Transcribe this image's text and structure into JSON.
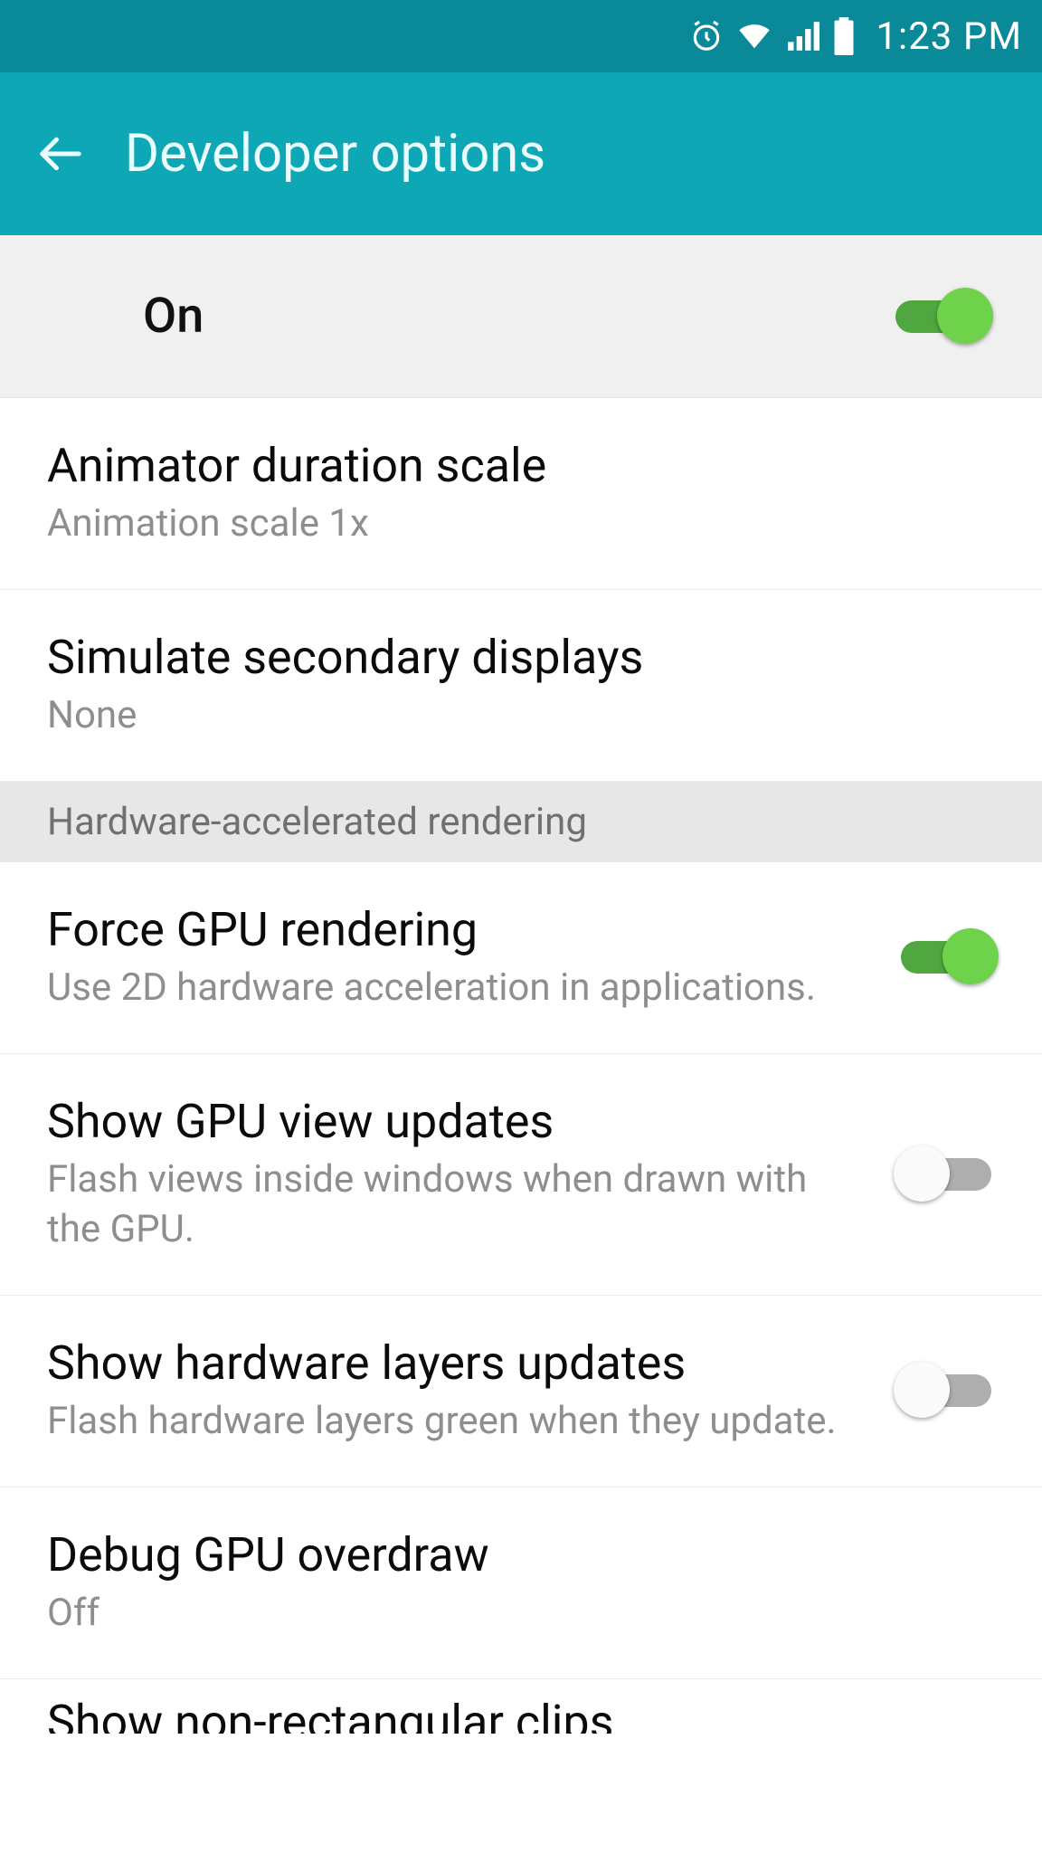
{
  "status": {
    "time": "1:23 PM"
  },
  "header": {
    "title": "Developer options"
  },
  "master": {
    "label": "On",
    "on": true
  },
  "items": [
    {
      "title": "Animator duration scale",
      "sub": "Animation scale 1x",
      "toggle": null
    },
    {
      "title": "Simulate secondary displays",
      "sub": "None",
      "toggle": null
    }
  ],
  "section_label": "Hardware-accelerated rendering",
  "items2": [
    {
      "title": "Force GPU rendering",
      "sub": "Use 2D hardware acceleration in applications.",
      "toggle": true
    },
    {
      "title": "Show GPU view updates",
      "sub": "Flash views inside windows when drawn with the GPU.",
      "toggle": false
    },
    {
      "title": "Show hardware layers updates",
      "sub": "Flash hardware layers green when they update.",
      "toggle": false
    },
    {
      "title": "Debug GPU overdraw",
      "sub": "Off",
      "toggle": null
    },
    {
      "title": "Show non-rectangular clips",
      "sub": "",
      "toggle": null
    }
  ]
}
